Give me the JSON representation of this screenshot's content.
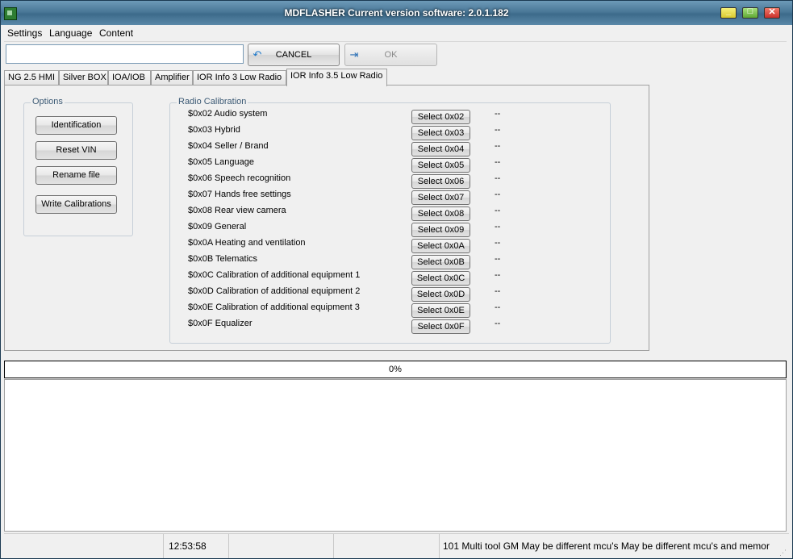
{
  "window": {
    "title": "MDFLASHER  Current version software: 2.0.1.182"
  },
  "menu": {
    "items": [
      "Settings",
      "Language",
      "Content"
    ]
  },
  "toolbar": {
    "path_value": "",
    "cancel_label": "CANCEL",
    "ok_label": "OK"
  },
  "tabs": [
    "NG 2.5 HMI",
    "Silver BOX",
    "IOA/IOB",
    "Amplifier",
    "IOR Info 3 Low Radio",
    "IOR Info 3.5 Low Radio"
  ],
  "active_tab": "IOR Info 3.5 Low Radio",
  "options": {
    "title": "Options",
    "buttons": [
      "Identification",
      "Reset VIN",
      "Rename file",
      "Write Calibrations"
    ]
  },
  "calibration": {
    "title": "Radio Calibration",
    "rows": [
      {
        "label": "$0x02 Audio system",
        "button": "Select 0x02",
        "value": "--"
      },
      {
        "label": "$0x03 Hybrid",
        "button": "Select 0x03",
        "value": "--"
      },
      {
        "label": "$0x04 Seller / Brand",
        "button": "Select 0x04",
        "value": "--"
      },
      {
        "label": "$0x05 Language",
        "button": "Select 0x05",
        "value": "--"
      },
      {
        "label": "$0x06 Speech recognition",
        "button": "Select 0x06",
        "value": "--"
      },
      {
        "label": "$0x07 Hands free settings",
        "button": "Select 0x07",
        "value": "--"
      },
      {
        "label": "$0x08 Rear view camera",
        "button": "Select 0x08",
        "value": "--"
      },
      {
        "label": "$0x09 General",
        "button": "Select 0x09",
        "value": "--"
      },
      {
        "label": "$0x0A Heating and ventilation",
        "button": "Select 0x0A",
        "value": "--"
      },
      {
        "label": "$0x0B Telematics",
        "button": "Select 0x0B",
        "value": "--"
      },
      {
        "label": "$0x0C Calibration of additional equipment 1",
        "button": "Select 0x0C",
        "value": "--"
      },
      {
        "label": "$0x0D Calibration of additional equipment 2",
        "button": "Select 0x0D",
        "value": "--"
      },
      {
        "label": "$0x0E Calibration of additional equipment 3",
        "button": "Select 0x0E",
        "value": "--"
      },
      {
        "label": "$0x0F Equalizer",
        "button": "Select 0x0F",
        "value": "--"
      }
    ]
  },
  "progress": {
    "label": "0%",
    "value": 0
  },
  "status": {
    "time": "12:53:58",
    "message": "101 Multi tool GM May be different mcu's May be different mcu's and memor"
  }
}
